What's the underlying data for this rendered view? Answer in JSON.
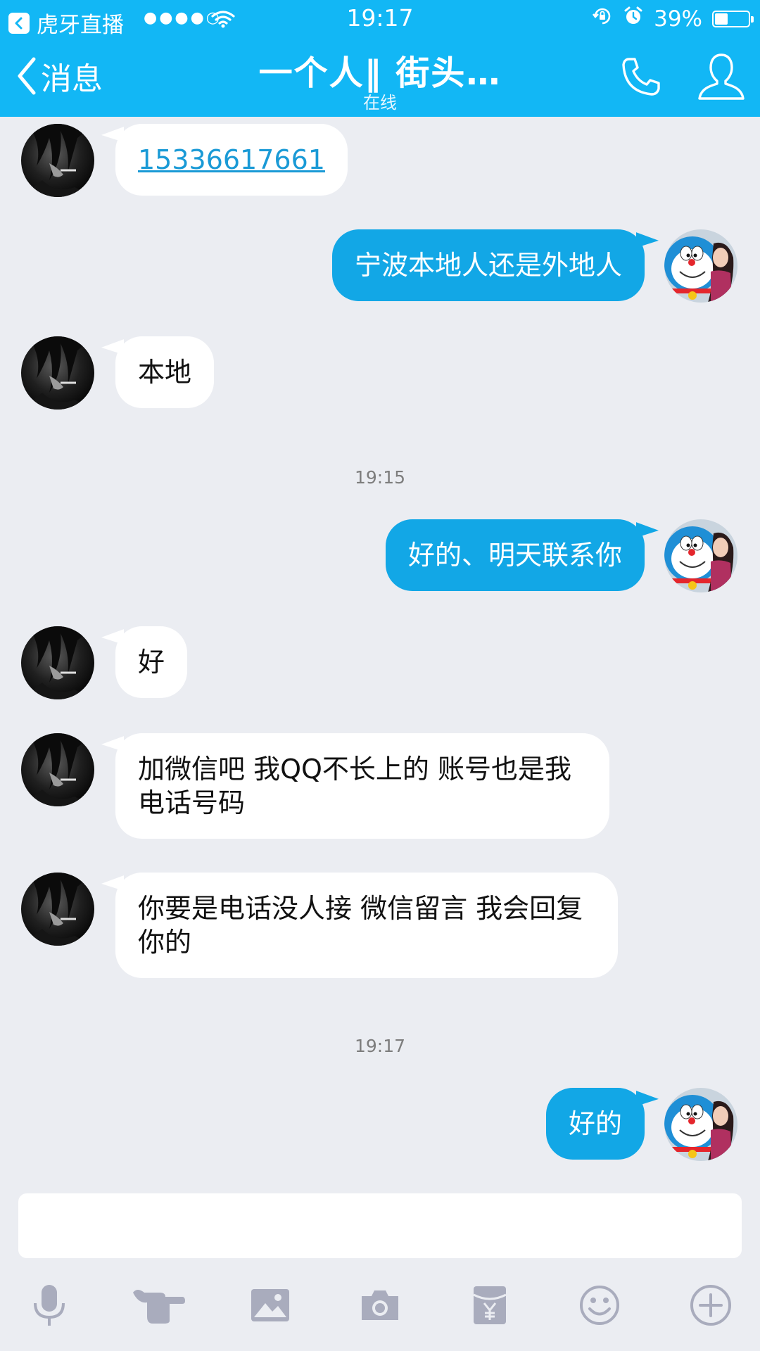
{
  "status_bar": {
    "app_back_label": "虎牙直播",
    "signal_dots": "●●●●○",
    "time": "19:17",
    "battery_percent": "39%",
    "battery_level": 0.39
  },
  "header": {
    "back_label": "消息",
    "title": "一个人‖  街头…",
    "subtitle": "在线"
  },
  "colors": {
    "header_bg": "#12b7f5",
    "outgoing_bubble": "#12a7e6",
    "incoming_bubble": "#ffffff",
    "chat_bg": "#ebedf2"
  },
  "messages": [
    {
      "side": "in",
      "text": "15336617661",
      "is_link": true
    },
    {
      "side": "out",
      "text": "宁波本地人还是外地人"
    },
    {
      "side": "in",
      "text": "本地"
    },
    {
      "timestamp": "19:15"
    },
    {
      "side": "out",
      "text": "好的、明天联系你"
    },
    {
      "side": "in",
      "text": "好"
    },
    {
      "side": "in",
      "text": "加微信吧 我QQ不长上的 账号也是我电话号码"
    },
    {
      "side": "in",
      "text": "你要是电话没人接 微信留言 我会回复你的"
    },
    {
      "timestamp": "19:17"
    },
    {
      "side": "out",
      "text": "好的"
    }
  ],
  "input": {
    "value": "",
    "placeholder": ""
  },
  "toolbar": {
    "icons": [
      "microphone-icon",
      "poke-hand-icon",
      "image-icon",
      "camera-icon",
      "red-packet-icon",
      "emoji-icon",
      "plus-icon"
    ]
  }
}
